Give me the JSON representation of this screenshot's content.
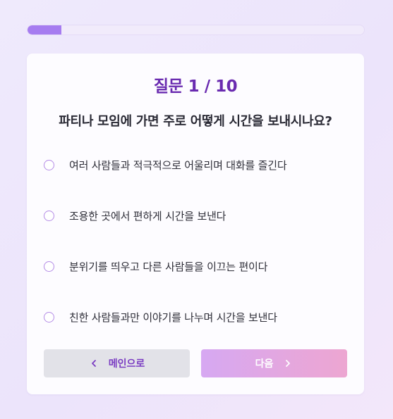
{
  "progress": {
    "fraction": 0.1
  },
  "quiz": {
    "counter": "질문 1 / 10",
    "question": "파티나 모임에 가면 주로 어떻게 시간을 보내시나요?",
    "options": [
      "여러 사람들과 적극적으로 어울리며 대화를 즐긴다",
      "조용한 곳에서 편하게 시간을 보낸다",
      "분위기를 띄우고 다른 사람들을 이끄는 편이다",
      "친한 사람들과만 이야기를 나누며 시간을 보낸다"
    ]
  },
  "buttons": {
    "main_label": "메인으로",
    "next_label": "다음"
  },
  "colors": {
    "accent": "#6a2bb0",
    "progress": "#a67cf0",
    "next_gradient_start": "#d5a4f2",
    "next_gradient_end": "#eda2cf"
  },
  "icons": {
    "back": "chevron-left-icon",
    "next": "chevron-right-icon"
  }
}
